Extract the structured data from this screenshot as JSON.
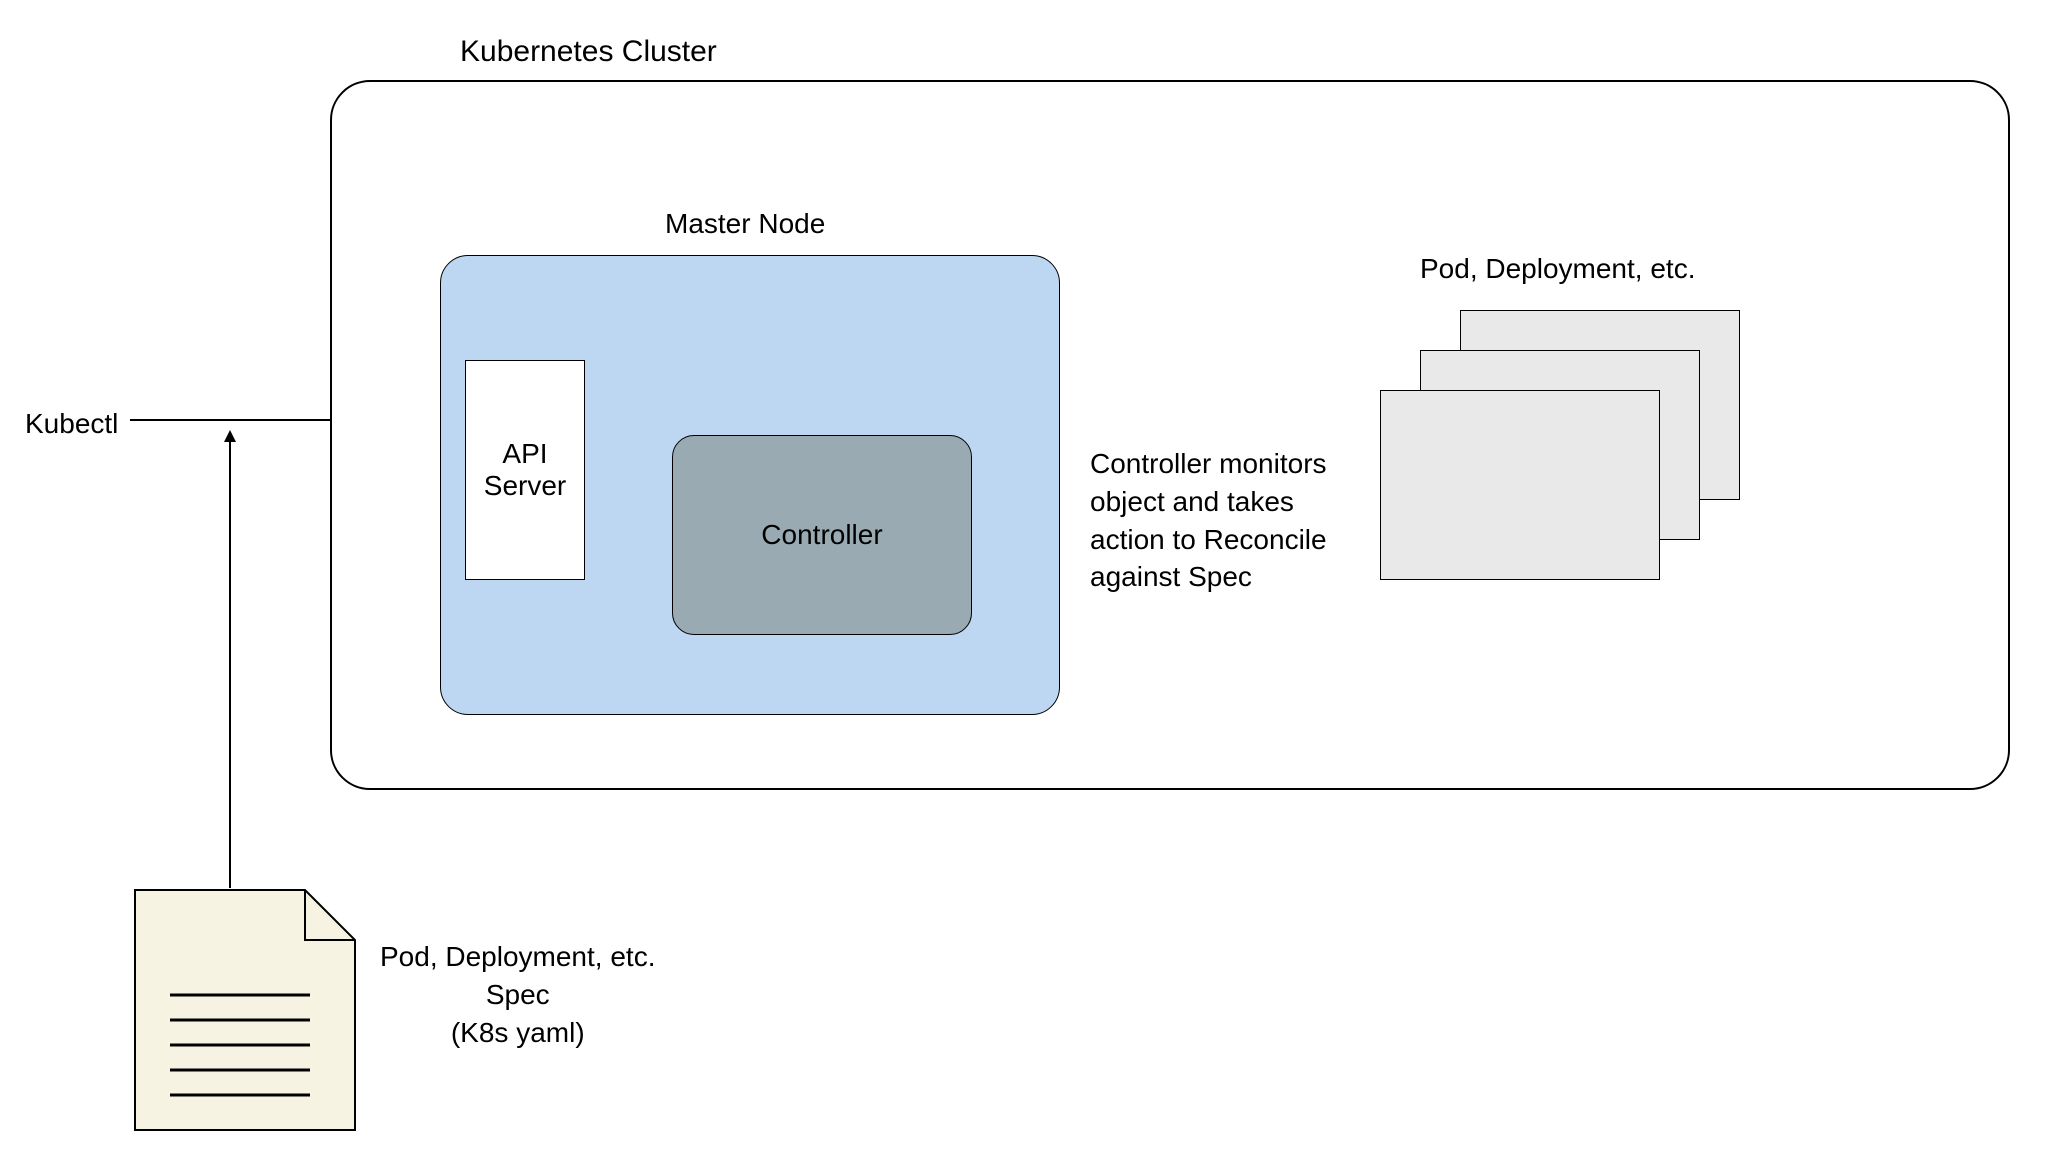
{
  "labels": {
    "cluster_title": "Kubernetes Cluster",
    "master_node": "Master Node",
    "kubectl": "Kubectl",
    "api_server": "API\nServer",
    "controller": "Controller",
    "controller_desc": "Controller monitors\nobject and takes\naction to Reconcile\nagainst Spec",
    "resources_title": "Pod, Deployment, etc.",
    "spec_label": "Pod, Deployment, etc.\nSpec\n(K8s yaml)"
  },
  "colors": {
    "master_bg": "#bdd7f2",
    "controller_bg": "#9aaab3",
    "resource_bg": "#e9e9e9",
    "doc_bg": "#f7f3e3"
  }
}
